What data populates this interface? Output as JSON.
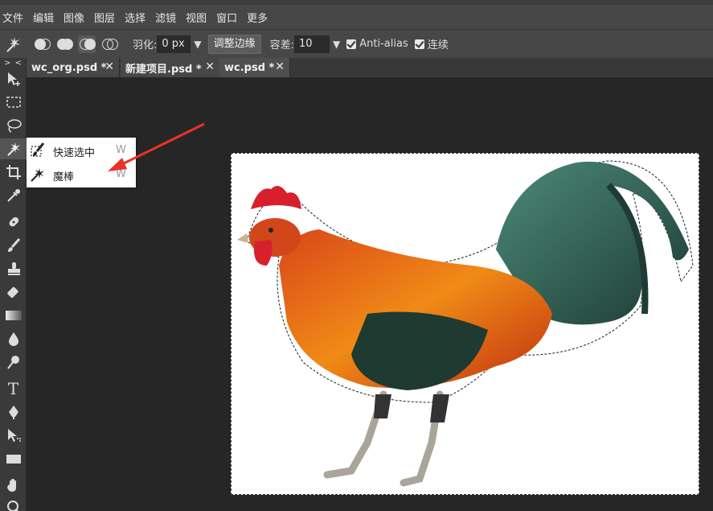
{
  "menu": [
    "文件",
    "编辑",
    "图像",
    "图层",
    "选择",
    "滤镜",
    "视图",
    "窗口",
    "更多"
  ],
  "options": {
    "feather_label": "羽化:",
    "feather_value": "0 px",
    "refine_edge_button": "调整边缘",
    "tolerance_label": "容差:",
    "tolerance_value": "10",
    "antialias_label": "Anti-alias",
    "contiguous_label": "连续"
  },
  "toolbar": {
    "collapse_label": "> <",
    "text_tool_glyph": "T"
  },
  "tabs": [
    {
      "label": "wc_org.psd *",
      "close": "✕"
    },
    {
      "label": "新建项目.psd *",
      "close": "✕"
    },
    {
      "label": "wc.psd *",
      "close": "✕"
    }
  ],
  "flyout": {
    "items": [
      {
        "label": "快速选中",
        "shortcut": "W",
        "icon": "quick-selection-icon"
      },
      {
        "label": "魔棒",
        "shortcut": "W",
        "icon": "magic-wand-icon"
      }
    ]
  },
  "canvas": {
    "image": "rooster-photo",
    "selection": "marching-ants"
  },
  "annotation": {
    "arrow_color": "#e8322a"
  }
}
